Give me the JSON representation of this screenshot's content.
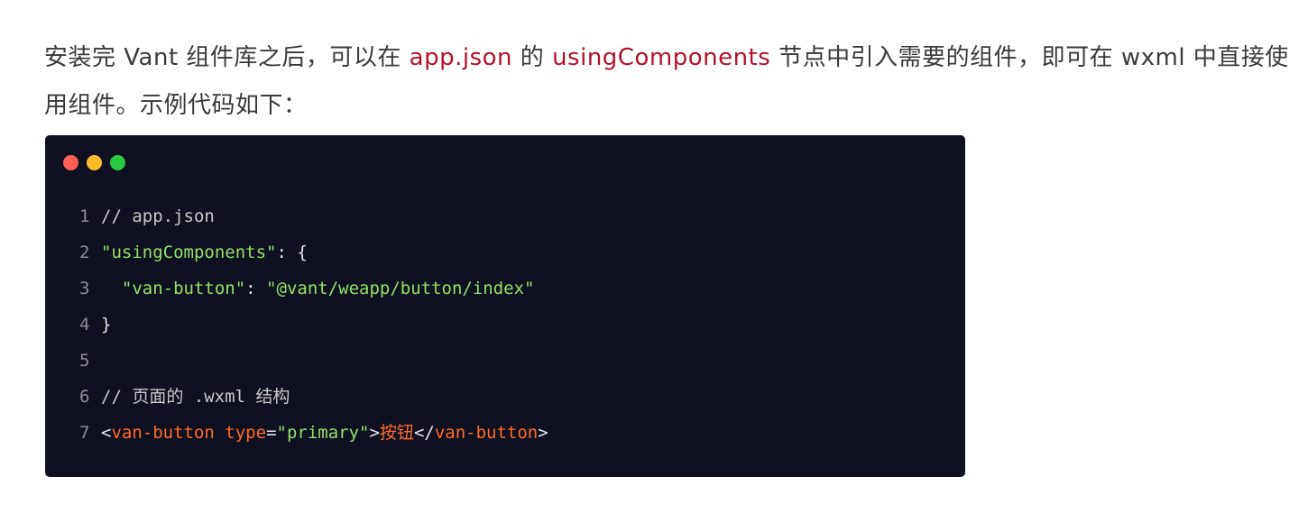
{
  "paragraph": {
    "part1": "安装完 Vant 组件库之后，可以在 ",
    "hl1": "app.json",
    "part2": " 的 ",
    "hl2": "usingComponents",
    "part3": " 节点中引入需要的组件，即可在 wxml 中直接使用组件。示例代码如下："
  },
  "colors": {
    "highlight": "#b3122b",
    "code_background": "#0f1020",
    "dot_red": "#ff5f56",
    "dot_yellow": "#ffbd2e",
    "dot_green": "#27c93f"
  },
  "code": {
    "lines": [
      {
        "n": "1",
        "comment": "// app.json"
      },
      {
        "n": "2",
        "key": "\"usingComponents\"",
        "rest": ": {"
      },
      {
        "n": "3",
        "indent": "  ",
        "key": "\"van-button\"",
        "sep": ": ",
        "value": "\"@vant/weapp/button/index\""
      },
      {
        "n": "4",
        "rest": "}"
      },
      {
        "n": "5"
      },
      {
        "n": "6",
        "comment": "// 页面的 .wxml 结构"
      },
      {
        "n": "7",
        "open": "<",
        "tag1": "van-button",
        "sp": " ",
        "attr": "type",
        "eq": "=",
        "attrval": "\"primary\"",
        "gt": ">",
        "text": "按钮",
        "close_open": "</",
        "tag2": "van-button",
        "close_gt": ">"
      }
    ]
  }
}
